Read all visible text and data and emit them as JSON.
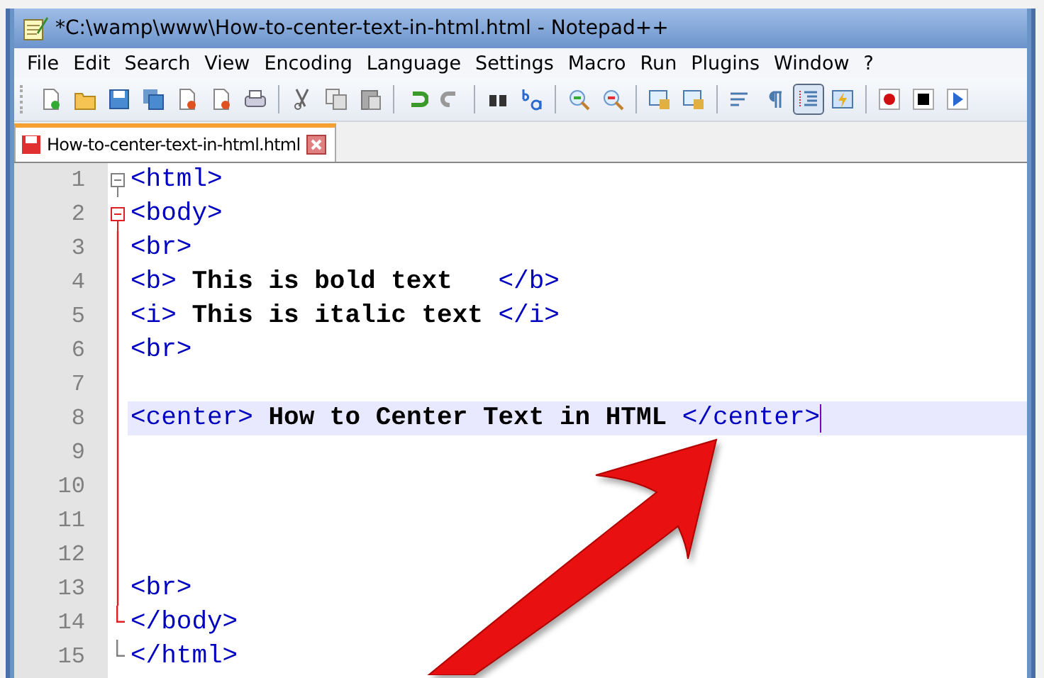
{
  "window": {
    "title": "*C:\\wamp\\www\\How-to-center-text-in-html.html - Notepad++"
  },
  "menu": [
    "File",
    "Edit",
    "Search",
    "View",
    "Encoding",
    "Language",
    "Settings",
    "Macro",
    "Run",
    "Plugins",
    "Window",
    "?"
  ],
  "toolbar": [
    [
      {
        "kind": "new",
        "pressed": false
      },
      {
        "kind": "open",
        "pressed": false
      },
      {
        "kind": "save",
        "pressed": false
      },
      {
        "kind": "save-all",
        "pressed": false
      },
      {
        "kind": "close",
        "pressed": false
      },
      {
        "kind": "close-all",
        "pressed": false
      },
      {
        "kind": "print",
        "pressed": false
      }
    ],
    [
      {
        "kind": "cut",
        "pressed": false
      },
      {
        "kind": "copy",
        "pressed": false
      },
      {
        "kind": "paste",
        "pressed": false
      }
    ],
    [
      {
        "kind": "undo",
        "pressed": false
      },
      {
        "kind": "redo",
        "pressed": false
      }
    ],
    [
      {
        "kind": "find",
        "pressed": false
      },
      {
        "kind": "replace",
        "pressed": false
      }
    ],
    [
      {
        "kind": "zoom-in",
        "pressed": false
      },
      {
        "kind": "zoom-out",
        "pressed": false
      }
    ],
    [
      {
        "kind": "sync-v",
        "pressed": false
      },
      {
        "kind": "sync-h",
        "pressed": false
      }
    ],
    [
      {
        "kind": "wrap",
        "pressed": false
      },
      {
        "kind": "pilcrow",
        "pressed": false
      },
      {
        "kind": "indent-guide",
        "pressed": true
      },
      {
        "kind": "lightning",
        "pressed": false
      }
    ],
    [
      {
        "kind": "record",
        "pressed": false
      },
      {
        "kind": "stop",
        "pressed": false
      },
      {
        "kind": "play",
        "pressed": false
      }
    ]
  ],
  "tabs": [
    {
      "label": "How-to-center-text-in-html.html",
      "selected": true,
      "modified": true
    }
  ],
  "editor": {
    "lines": [
      {
        "number": "1",
        "current": false,
        "segments": [
          {
            "kind": "tag",
            "text": "<html>"
          }
        ],
        "children": [
          {
            "number": "2",
            "current": false,
            "segments": [
              {
                "kind": "tag",
                "text": "<body>"
              }
            ],
            "children": [
              {
                "number": "3",
                "current": false,
                "segments": [
                  {
                    "kind": "tag",
                    "text": "<br>"
                  }
                ]
              },
              {
                "number": "4",
                "current": false,
                "segments": [
                  {
                    "kind": "tag",
                    "text": "<b>"
                  },
                  {
                    "kind": "text",
                    "text": " This is bold text   "
                  },
                  {
                    "kind": "tag",
                    "text": "</b>"
                  }
                ]
              },
              {
                "number": "5",
                "current": false,
                "segments": [
                  {
                    "kind": "tag",
                    "text": "<i>"
                  },
                  {
                    "kind": "text",
                    "text": " This is italic text "
                  },
                  {
                    "kind": "tag",
                    "text": "</i>"
                  }
                ]
              },
              {
                "number": "6",
                "current": false,
                "segments": [
                  {
                    "kind": "tag",
                    "text": "<br>"
                  }
                ]
              },
              {
                "number": "7",
                "current": false
              },
              {
                "number": "8",
                "current": true,
                "segments": [
                  {
                    "kind": "tag",
                    "text": "<center>"
                  },
                  {
                    "kind": "text",
                    "text": " How to Center Text in HTML "
                  },
                  {
                    "kind": "tag",
                    "text": "</center>"
                  }
                ]
              },
              {
                "number": "9",
                "current": false
              },
              {
                "number": "10",
                "current": false
              },
              {
                "number": "11",
                "current": false
              },
              {
                "number": "12",
                "current": false
              },
              {
                "number": "13",
                "current": false,
                "segments": [
                  {
                    "kind": "tag",
                    "text": "<br>"
                  }
                ]
              },
              {
                "number": "14",
                "current": false,
                "segments": [
                  {
                    "kind": "tag",
                    "text": "</body>"
                  }
                ]
              }
            ]
          },
          {
            "number": "15",
            "current": false,
            "segments": [
              {
                "kind": "tag",
                "text": "</html>"
              }
            ]
          }
        ]
      }
    ]
  }
}
